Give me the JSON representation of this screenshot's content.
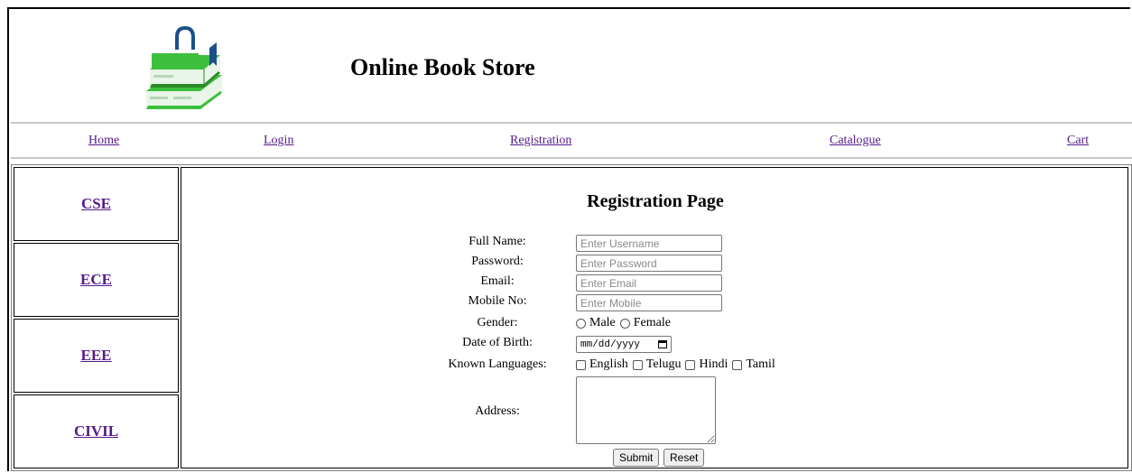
{
  "header": {
    "title": "Online Book Store",
    "logo_icon": "book-stack-bag-icon",
    "colors": {
      "book_green": "#3cbf3c",
      "book_dark": "#2a8a2a",
      "handle_blue": "#1b4f8a"
    }
  },
  "nav": {
    "items": [
      "Home",
      "Login",
      "Registration",
      "Catalogue",
      "Cart"
    ],
    "link_color": "#551a8b"
  },
  "sidebar": {
    "items": [
      "CSE",
      "ECE",
      "EEE",
      "CIVIL"
    ]
  },
  "registration": {
    "title": "Registration Page",
    "fields": {
      "full_name": {
        "label": "Full Name:",
        "placeholder": "Enter Username"
      },
      "password": {
        "label": "Password:",
        "placeholder": "Enter Password"
      },
      "email": {
        "label": "Email:",
        "placeholder": "Enter Email"
      },
      "mobile": {
        "label": "Mobile No:",
        "placeholder": "Enter Mobile"
      },
      "gender": {
        "label": "Gender:",
        "options": [
          "Male",
          "Female"
        ]
      },
      "dob": {
        "label": "Date of Birth:",
        "placeholder": "mm/dd/yyyy"
      },
      "languages": {
        "label": "Known Languages:",
        "options": [
          "English",
          "Telugu",
          "Hindi",
          "Tamil"
        ]
      },
      "address": {
        "label": "Address:"
      }
    },
    "buttons": {
      "submit": "Submit",
      "reset": "Reset"
    }
  }
}
